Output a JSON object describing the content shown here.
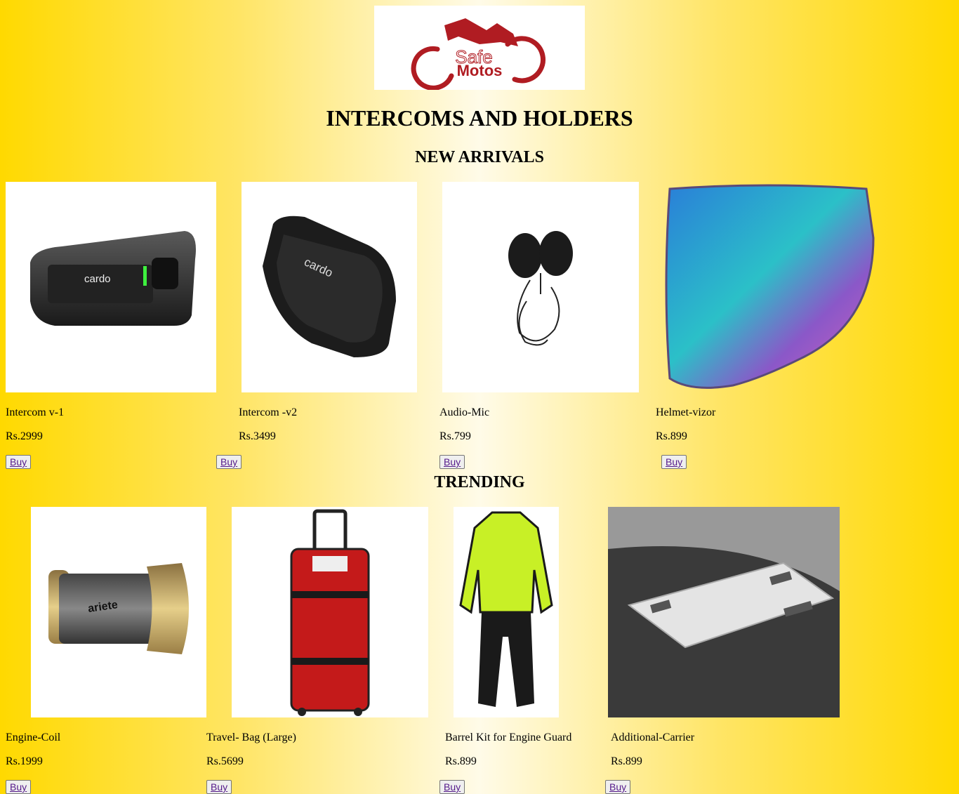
{
  "brand": {
    "logo_top": "Safe",
    "logo_bottom": "Motos",
    "logo_color": "#b01c22"
  },
  "page_title": "INTERCOMS AND HOLDERS",
  "sections": {
    "new_arrivals": {
      "heading": "NEW ARRIVALS",
      "products": [
        {
          "name": "Intercom v-1",
          "price": "Rs.2999",
          "buy": "Buy",
          "image_icon": "cardo-intercom-icon"
        },
        {
          "name": "Intercom -v2",
          "price": "Rs.3499",
          "buy": "Buy",
          "image_icon": "cardo-intercom-icon"
        },
        {
          "name": "Audio-Mic",
          "price": "Rs.799",
          "buy": "Buy",
          "image_icon": "headset-speaker-icon"
        },
        {
          "name": "Helmet-vizor",
          "price": "Rs.899",
          "buy": "Buy",
          "image_icon": "helmet-visor-icon"
        }
      ]
    },
    "trending": {
      "heading": "TRENDING",
      "products": [
        {
          "name": "Engine-Coil",
          "price": "Rs.1999",
          "buy": "Buy",
          "image_icon": "grip-coil-icon"
        },
        {
          "name": "Travel- Bag (Large)",
          "price": "Rs.5699",
          "buy": "Buy",
          "image_icon": "travel-bag-icon"
        },
        {
          "name": "Barrel Kit for Engine Guard",
          "price": "Rs.899",
          "buy": "Buy",
          "image_icon": "rain-suit-icon"
        },
        {
          "name": "Additional-Carrier",
          "price": "Rs.899",
          "buy": "Buy",
          "image_icon": "luggage-rack-icon"
        }
      ]
    }
  }
}
